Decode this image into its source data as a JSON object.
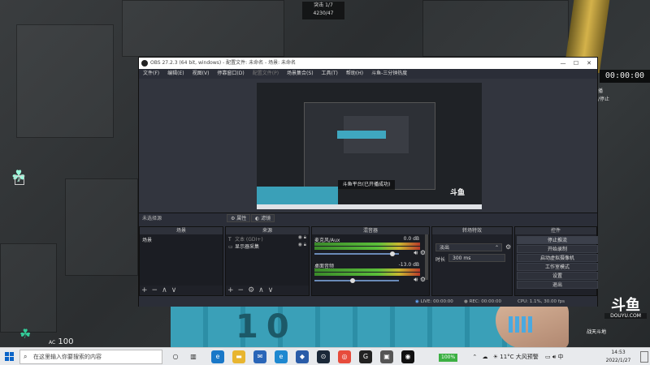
{
  "game": {
    "hud_top_line1": "突击  1/7",
    "hud_top_line2": "4230/47",
    "timer": "00:00:00",
    "side_text1": "播",
    "side_text2": "/停止",
    "health_label": "AC",
    "health_value": "100",
    "floor_text": "10",
    "level_badge": "7",
    "douyu_logo": "斗鱼",
    "douyu_site": "DOUYU.COM",
    "douyu_user": "战天斗地"
  },
  "obs": {
    "title": "OBS 27.2.3 (64 bit, windows) - 配置文件: 未命名 - 场景: 未命名",
    "menu": [
      {
        "label": "文件(F)",
        "enabled": true
      },
      {
        "label": "编辑(E)",
        "enabled": true
      },
      {
        "label": "视图(V)",
        "enabled": true
      },
      {
        "label": "停靠窗口(D)",
        "enabled": true
      },
      {
        "label": "配置文件(P)",
        "enabled": false
      },
      {
        "label": "场景集合(S)",
        "enabled": true
      },
      {
        "label": "工具(T)",
        "enabled": true
      },
      {
        "label": "帮助(H)",
        "enabled": true
      },
      {
        "label": "斗鱼-三分钟热度",
        "enabled": true
      }
    ],
    "preview_toast": "斗鱼平台(已开播成功)",
    "no_source_selected": "未选择源",
    "filter_buttons": [
      "属性",
      "滤镜"
    ],
    "panels": {
      "scenes": {
        "title": "场景",
        "items": [
          "场景"
        ]
      },
      "sources": {
        "title": "来源",
        "items": [
          {
            "icon": "T",
            "name": "文本 (GDI+)"
          },
          {
            "icon": "▭",
            "name": "显示器采集"
          }
        ]
      },
      "mixer": {
        "title": "混音器",
        "channels": [
          {
            "name": "麦克风/Aux",
            "db": "0.0 dB",
            "level": 0.92
          },
          {
            "name": "桌面音频",
            "db": "-13.0 dB",
            "level": 0.45
          }
        ]
      },
      "transitions": {
        "title": "转场特效",
        "selected": "淡出",
        "duration_label": "时长",
        "duration": "300 ms"
      },
      "controls": {
        "title": "控件",
        "buttons": [
          "停止推流",
          "开始录制",
          "启动虚拟摄像机",
          "工作室模式",
          "设置",
          "退出"
        ]
      }
    },
    "status": {
      "live": "LIVE: 00:00:00",
      "rec": "REC: 00:00:00",
      "cpu": "CPU: 1.1%, 30.00 fps"
    }
  },
  "taskbar": {
    "search_placeholder": "在这里输入你要搜索的内容",
    "battery": "100%",
    "weather": "11°C  大风预警",
    "time": "14:53",
    "date": "2022/1/27",
    "ime": "中"
  }
}
